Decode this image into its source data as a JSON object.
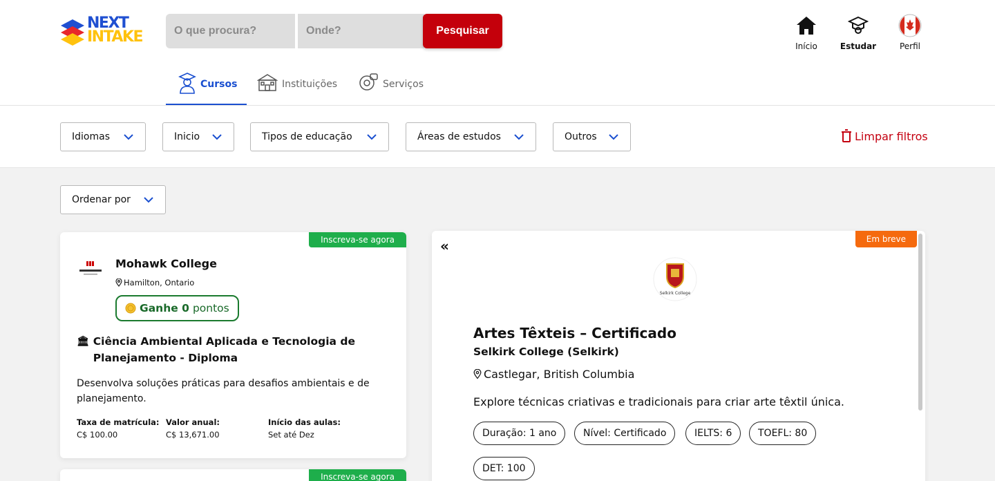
{
  "header": {
    "logo": {
      "line1": "NEXT",
      "line2": "INTAKE"
    },
    "search": {
      "what_placeholder": "O que procura?",
      "where_placeholder": "Onde?",
      "button_label": "Pesquisar"
    },
    "nav": [
      {
        "label": "Início",
        "icon": "home-icon"
      },
      {
        "label": "Estudar",
        "icon": "graduation-icon"
      },
      {
        "label": "Perfil",
        "icon": "canada-flag-avatar"
      }
    ],
    "tabs": [
      {
        "label": "Cursos",
        "icon": "student-icon"
      },
      {
        "label": "Instituições",
        "icon": "school-building-icon"
      },
      {
        "label": "Serviços",
        "icon": "services-icon"
      }
    ]
  },
  "filters": {
    "items": [
      "Idiomas",
      "Inicio",
      "Tipos de educação",
      "Áreas de estudos",
      "Outros"
    ],
    "clear_label": "Limpar filtros",
    "sort_label": "Ordenar por"
  },
  "course_card": {
    "badge": "Inscreva-se agora",
    "institution": "Mohawk College",
    "location": "Hamilton, Ontario",
    "points_prefix": "Ganhe 0",
    "points_suffix": "pontos",
    "title": "Ciência Ambiental Aplicada e Tecnologia de Planejamento - Diploma",
    "description": "Desenvolva soluções práticas para desafios ambientais e de planejamento.",
    "fees": [
      {
        "label": "Taxa de matrícula:",
        "value": "C$ 100.00"
      },
      {
        "label": "Valor anual:",
        "value": "C$ 13,671.00"
      },
      {
        "label": "Início das aulas:",
        "value": "Set até Dez"
      }
    ]
  },
  "course_card_2": {
    "badge": "Inscreva-se agora"
  },
  "detail": {
    "badge": "Em breve",
    "logo_caption": "Selkirk College",
    "title": "Artes Têxteis – Certificado",
    "institution": "Selkirk College (Selkirk)",
    "location": "Castlegar, British Columbia",
    "description": "Explore técnicas criativas e tradicionais para criar arte têxtil única.",
    "pills": [
      "Duração: 1 ano",
      "Nível: Certificado",
      "IELTS: 6",
      "TOEFL: 80",
      "DET: 100"
    ]
  },
  "colors": {
    "brand_red": "#c4000b",
    "accent_blue": "#1a4fd0",
    "green": "#1eae4b",
    "orange": "#f56a0e"
  }
}
